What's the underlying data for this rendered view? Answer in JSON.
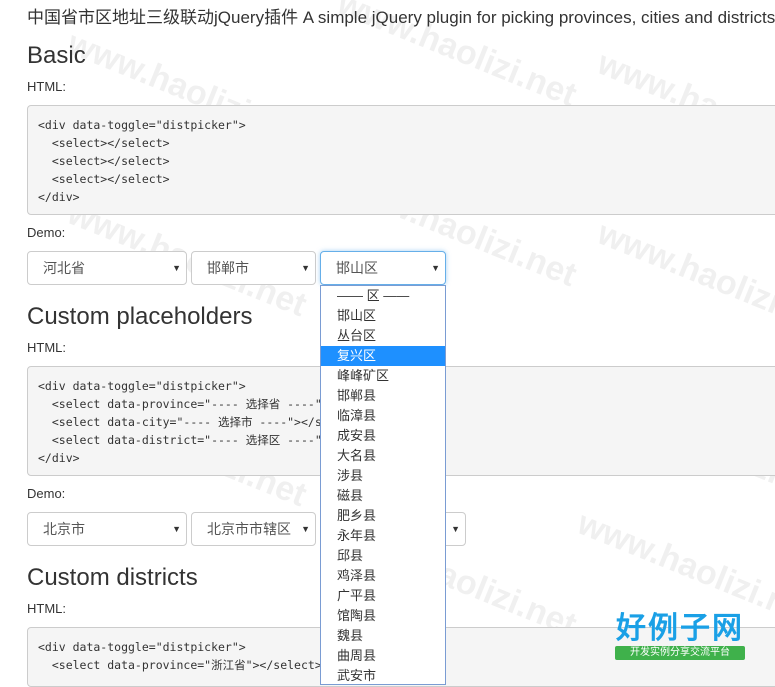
{
  "header": {
    "title": "中国省市区地址三级联动jQuery插件 A simple jQuery plugin for picking provinces, cities and districts"
  },
  "sections": {
    "basic": {
      "title": "Basic",
      "html_label": "HTML:",
      "code": [
        "<div data-toggle=\"distpicker\">",
        "  <select></select>",
        "  <select></select>",
        "  <select></select>",
        "</div>"
      ],
      "demo_label": "Demo:",
      "province": "河北省",
      "city": "邯郸市",
      "district": "邯山区"
    },
    "custom_placeholders": {
      "title": "Custom placeholders",
      "html_label": "HTML:",
      "code": [
        "<div data-toggle=\"distpicker\">",
        "  <select data-province=\"---- 选择省 ----\"></select>",
        "  <select data-city=\"---- 选择市 ----\"></select>",
        "  <select data-district=\"---- 选择区 ----\"></select>",
        "</div>"
      ],
      "demo_label": "Demo:",
      "province": "北京市",
      "city": "北京市市辖区"
    },
    "custom_districts": {
      "title": "Custom districts",
      "html_label": "HTML:",
      "code": [
        "<div data-toggle=\"distpicker\">",
        "  <select data-province=\"浙江省\"></select>"
      ]
    }
  },
  "dropdown": {
    "options": [
      "—— 区 ——",
      "邯山区",
      "丛台区",
      "复兴区",
      "峰峰矿区",
      "邯郸县",
      "临漳县",
      "成安县",
      "大名县",
      "涉县",
      "磁县",
      "肥乡县",
      "永年县",
      "邱县",
      "鸡泽县",
      "广平县",
      "馆陶县",
      "魏县",
      "曲周县",
      "武安市"
    ],
    "highlighted_index": 3
  },
  "watermark": "www.haolizi.net",
  "logo": {
    "main": "好例子网",
    "sub": "开发实例分享交流平台"
  },
  "colors": {
    "highlight": "#1e90ff",
    "focus_border": "#66afe9",
    "logo_blue": "#1aa0e6",
    "logo_green": "#3fb14b"
  }
}
